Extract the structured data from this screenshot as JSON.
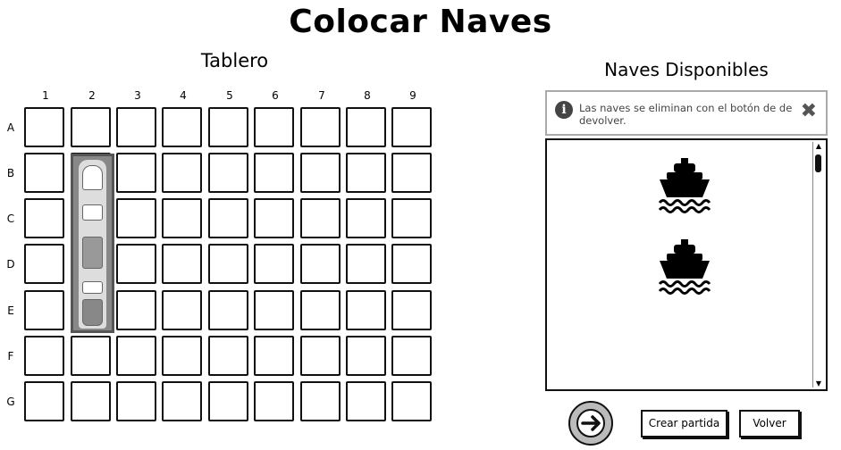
{
  "page": {
    "title": "Colocar Naves"
  },
  "board": {
    "title": "Tablero",
    "columns": [
      "1",
      "2",
      "3",
      "4",
      "5",
      "6",
      "7",
      "8",
      "9"
    ],
    "rows": [
      "A",
      "B",
      "C",
      "D",
      "E",
      "F",
      "G"
    ],
    "placed_ship": {
      "column": "2",
      "rows": [
        "B",
        "C",
        "D",
        "E"
      ]
    }
  },
  "panel": {
    "title": "Naves Disponibles",
    "alert": {
      "icon": "info-icon",
      "text": "Las naves se eliminan con el botón de de devolver.",
      "close_icon": "close-icon"
    },
    "ships": [
      {
        "icon": "ship-icon"
      },
      {
        "icon": "ship-icon"
      }
    ]
  },
  "actions": {
    "next_icon": "arrow-right-icon",
    "create_label": "Crear partida",
    "back_label": "Volver"
  }
}
